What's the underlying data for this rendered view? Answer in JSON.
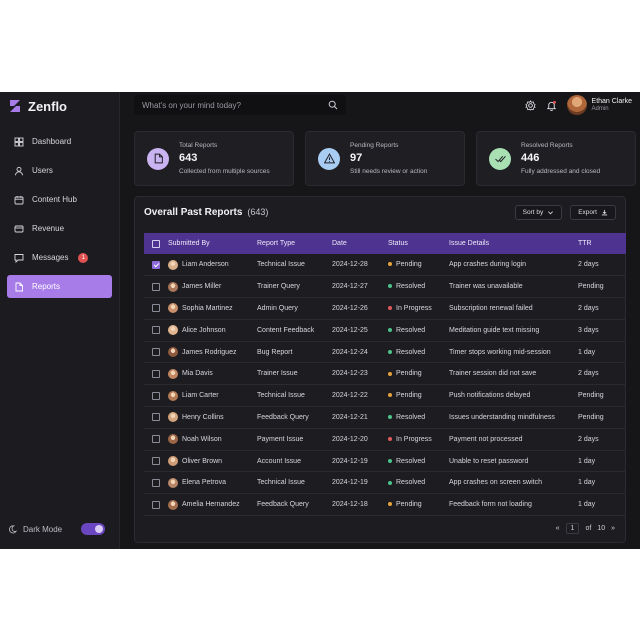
{
  "app": {
    "name": "Zenflo",
    "brand_color": "#a77be8"
  },
  "sidebar": {
    "items": [
      {
        "label": "Dashboard",
        "icon": "grid-icon"
      },
      {
        "label": "Users",
        "icon": "user-icon"
      },
      {
        "label": "Content Hub",
        "icon": "calendar-icon"
      },
      {
        "label": "Revenue",
        "icon": "card-icon"
      },
      {
        "label": "Messages",
        "icon": "message-icon",
        "badge": "1"
      },
      {
        "label": "Reports",
        "icon": "document-icon",
        "active": true
      }
    ],
    "dark_mode_label": "Dark Mode",
    "dark_mode_on": true
  },
  "topbar": {
    "search_placeholder": "What's on your mind today?",
    "user_name": "Ethan Clarke",
    "user_role": "Admin"
  },
  "stats": [
    {
      "label": "Total Reports",
      "value": "643",
      "sub": "Collected from multiple sources",
      "icon": "document-icon",
      "color": "#c9b3f0"
    },
    {
      "label": "Pending Reports",
      "value": "97",
      "sub": "Still needs review or action",
      "icon": "warning-icon",
      "color": "#a9cdf2"
    },
    {
      "label": "Resolved Reports",
      "value": "446",
      "sub": "Fully addressed and closed",
      "icon": "double-check-icon",
      "color": "#a8e0b4"
    }
  ],
  "reports": {
    "title": "Overall Past Reports",
    "count": "(643)",
    "sort_label": "Sort by",
    "export_label": "Export",
    "columns": [
      "Submitted By",
      "Report Type",
      "Date",
      "Status",
      "Issue Details",
      "TTR"
    ],
    "rows": [
      {
        "checked": true,
        "name": "Liam Anderson",
        "type": "Technical Issue",
        "date": "2024-12-28",
        "status": "Pending",
        "issue": "App crashes during login",
        "ttr": "2 days"
      },
      {
        "checked": false,
        "name": "James Miller",
        "type": "Trainer Query",
        "date": "2024-12-27",
        "status": "Resolved",
        "issue": "Trainer was unavailable",
        "ttr": "Pending"
      },
      {
        "checked": false,
        "name": "Sophia Martinez",
        "type": "Admin Query",
        "date": "2024-12-26",
        "status": "In Progress",
        "issue": "Subscription renewal failed",
        "ttr": "2 days"
      },
      {
        "checked": false,
        "name": "Alice Johnson",
        "type": "Content Feedback",
        "date": "2024-12-25",
        "status": "Resolved",
        "issue": "Meditation guide text missing",
        "ttr": "3 days"
      },
      {
        "checked": false,
        "name": "James Rodriguez",
        "type": "Bug Report",
        "date": "2024-12-24",
        "status": "Resolved",
        "issue": "Timer stops working mid-session",
        "ttr": "1 day"
      },
      {
        "checked": false,
        "name": "Mia Davis",
        "type": "Trainer Issue",
        "date": "2024-12-23",
        "status": "Pending",
        "issue": "Trainer session did not save",
        "ttr": "2 days"
      },
      {
        "checked": false,
        "name": "Liam Carter",
        "type": "Technical Issue",
        "date": "2024-12-22",
        "status": "Pending",
        "issue": "Push notifications delayed",
        "ttr": "Pending"
      },
      {
        "checked": false,
        "name": "Henry Collins",
        "type": "Feedback Query",
        "date": "2024-12-21",
        "status": "Resolved",
        "issue": "Issues understanding mindfulness",
        "ttr": "Pending"
      },
      {
        "checked": false,
        "name": "Noah Wilson",
        "type": "Payment Issue",
        "date": "2024-12-20",
        "status": "In Progress",
        "issue": "Payment not processed",
        "ttr": "2 days"
      },
      {
        "checked": false,
        "name": "Oliver Brown",
        "type": "Account Issue",
        "date": "2024-12-19",
        "status": "Resolved",
        "issue": "Unable to reset password",
        "ttr": "1 day"
      },
      {
        "checked": false,
        "name": "Elena Petrova",
        "type": "Technical Issue",
        "date": "2024-12-19",
        "status": "Resolved",
        "issue": "App crashes on screen switch",
        "ttr": "1 day"
      },
      {
        "checked": false,
        "name": "Amelia Hernandez",
        "type": "Feedback Query",
        "date": "2024-12-18",
        "status": "Pending",
        "issue": "Feedback form not loading",
        "ttr": "1 day"
      }
    ],
    "status_colors": {
      "Pending": "#e6a23c",
      "Resolved": "#4cc38a",
      "In Progress": "#e05a5a"
    },
    "pagination": {
      "current": "1",
      "of_label": "of",
      "total": "10"
    }
  }
}
